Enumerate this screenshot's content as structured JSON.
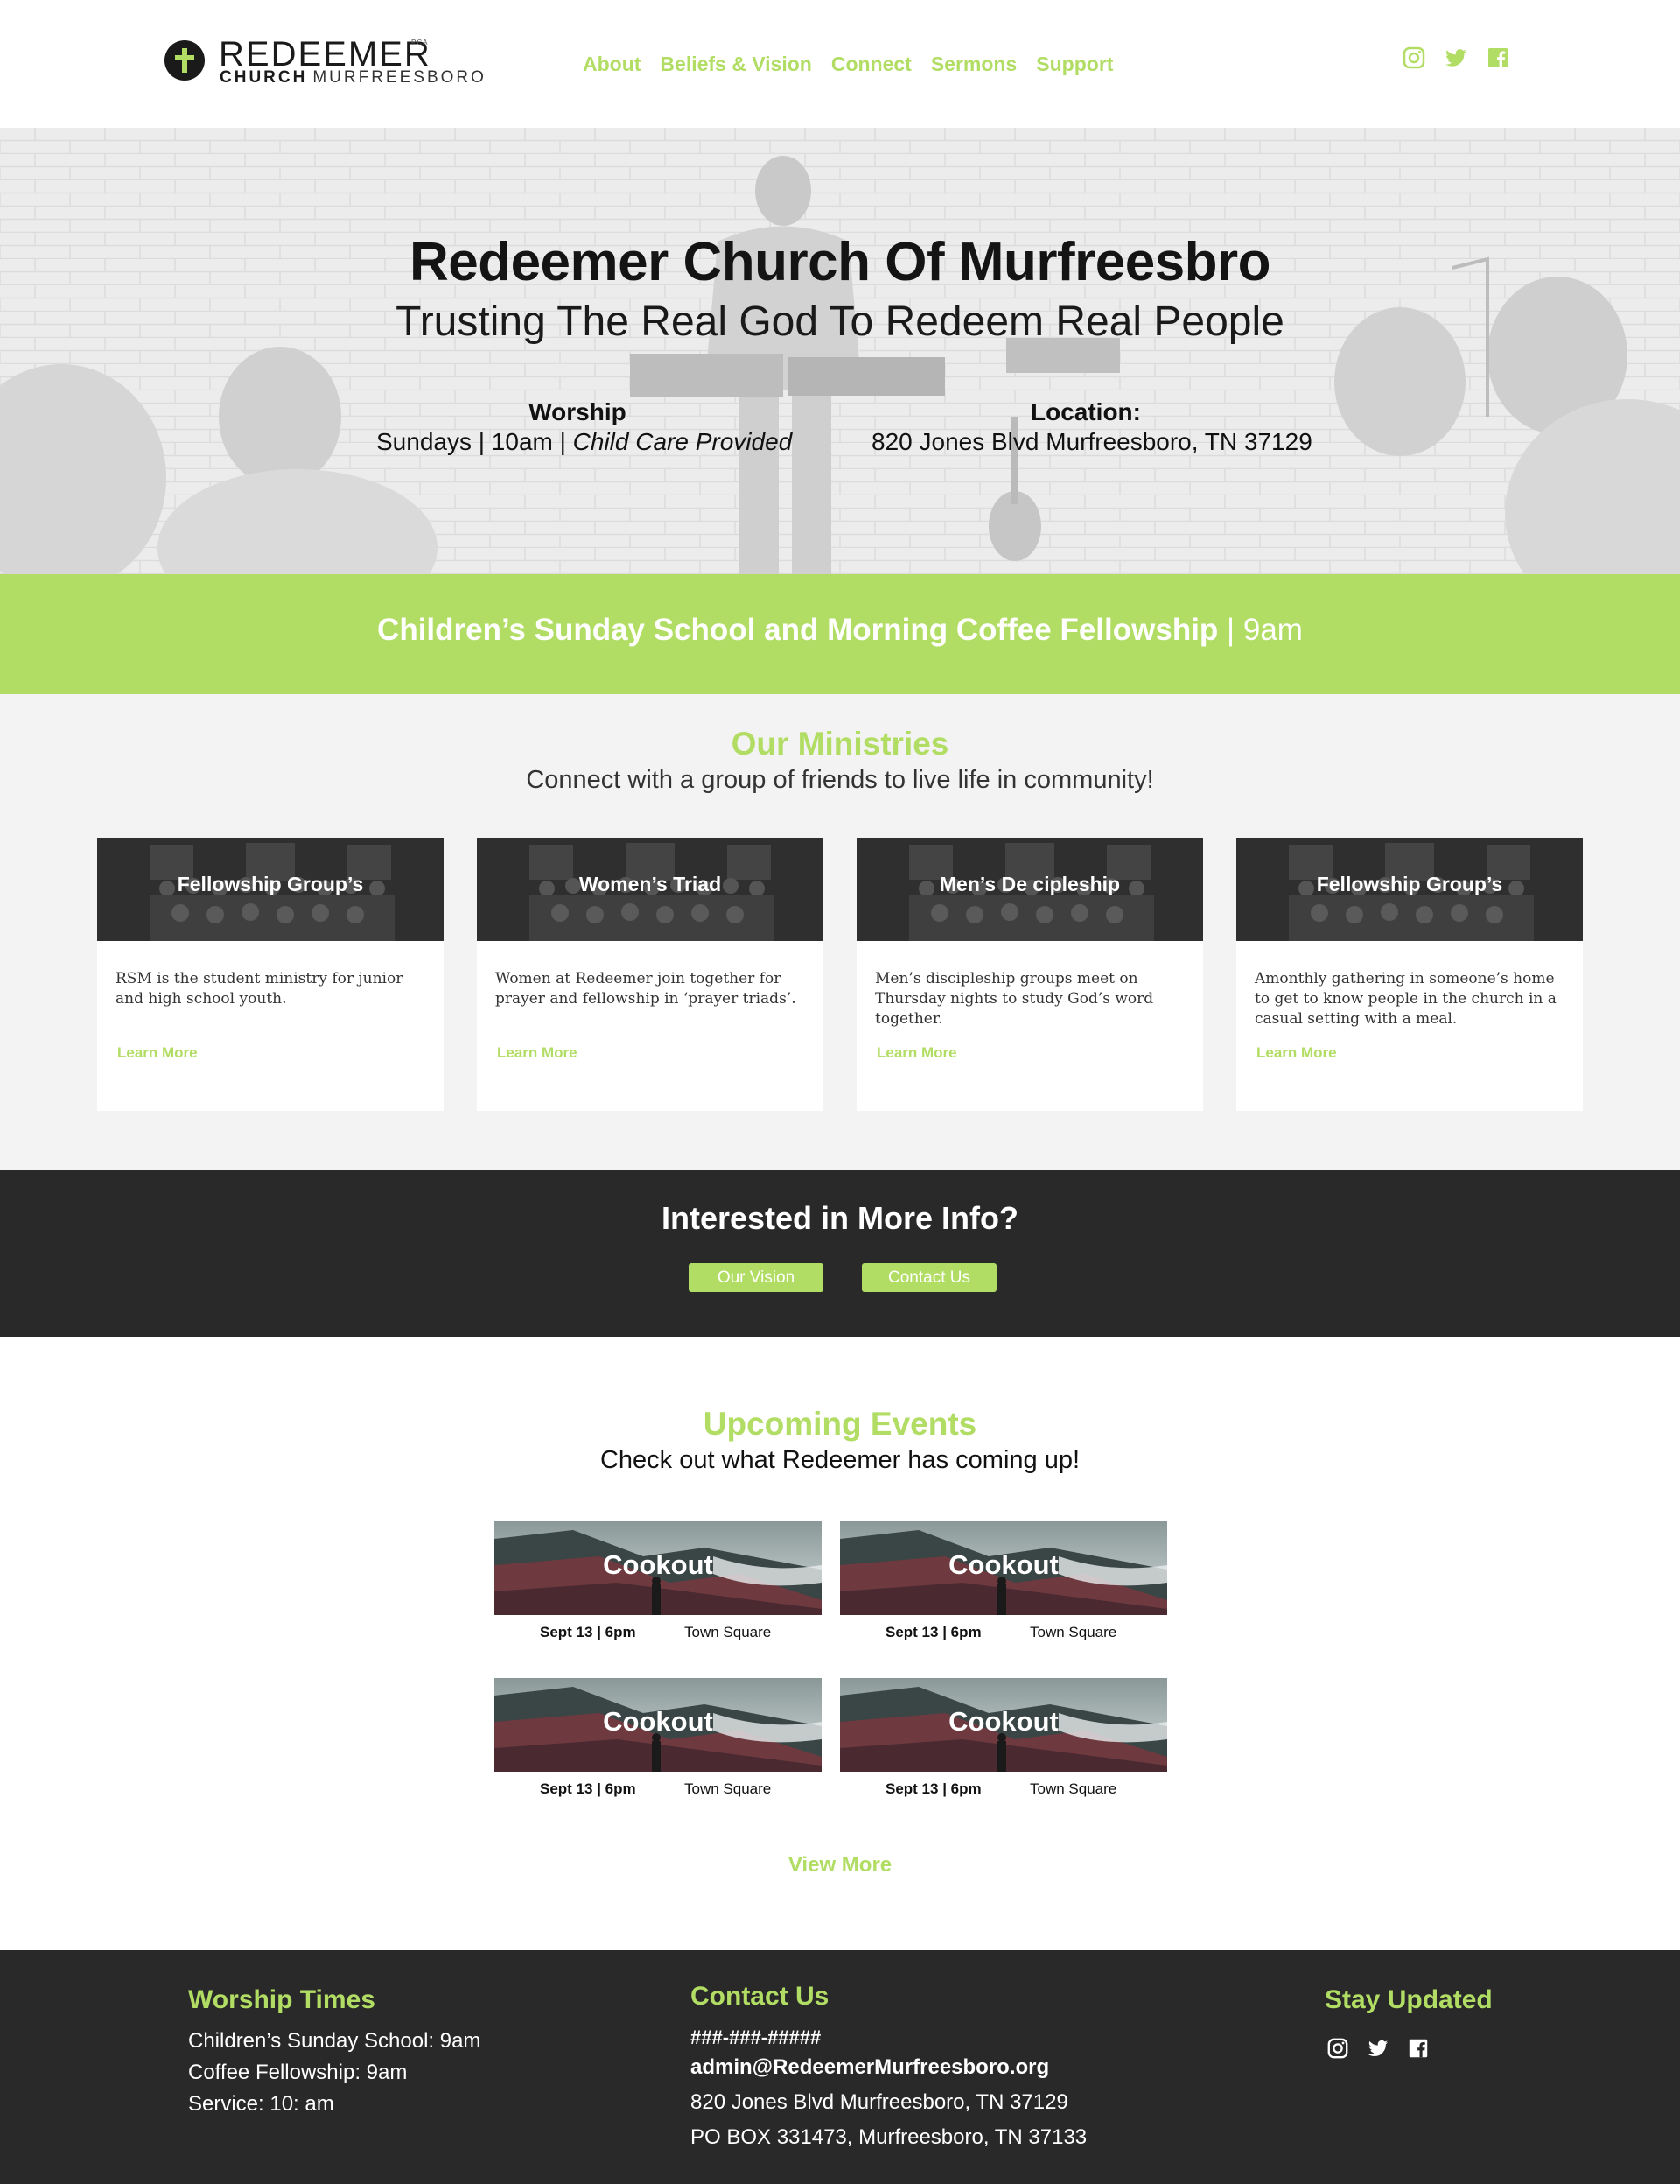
{
  "brand": {
    "name_line1": "REDEEMER",
    "pca": "PCA",
    "name_bold": "CHURCH",
    "name_light": "MURFREESBORO"
  },
  "nav": {
    "items": [
      "About",
      "Beliefs & Vision",
      "Connect",
      "Sermons",
      "Support"
    ]
  },
  "social": {
    "icons": [
      "instagram-icon",
      "twitter-icon",
      "facebook-icon"
    ],
    "color": "#b2dd64"
  },
  "hero": {
    "title": "Redeemer Church Of Murfreesbro",
    "subtitle": "Trusting The Real God  To Redeem Real People",
    "worship_heading": "Worship",
    "worship_text": "Sundays | 10am | ",
    "worship_italic": "Child Care Provided",
    "location_heading": "Location:",
    "location_text": "820 Jones Blvd Murfreesboro, TN 37129"
  },
  "banner": {
    "bold": "Children’s Sunday School and Morning Coffee Fellowship",
    "rest": " | 9am"
  },
  "ministries": {
    "title": "Our Ministries",
    "subtitle": "Connect with a group of friends to live life in community!",
    "cards": [
      {
        "title": "Fellowship Group’s",
        "desc": "RSM is the student ministry for junior and high school youth.",
        "link": "Learn More"
      },
      {
        "title": "Women’s Triad",
        "desc": "Women at Redeemer join together for prayer and fellowship in ‘prayer triads’.",
        "link": "Learn More"
      },
      {
        "title": "Men’s De cipleship",
        "desc": "Men’s discipleship groups meet on Thursday nights to study God’s word together.",
        "link": "Learn More"
      },
      {
        "title": "Fellowship Group’s",
        "desc": " Amonthly gathering in someone’s home to get to know people in the church in a casual setting with a meal.",
        "link": "Learn More"
      }
    ]
  },
  "info": {
    "title": "Interested in More Info?",
    "btn_vision": "Our Vision",
    "btn_contact": "Contact Us"
  },
  "events": {
    "title": "Upcoming Events",
    "subtitle": "Check out what Redeemer has coming up!",
    "items": [
      {
        "title": "Cookout",
        "date": "Sept 13 | 6pm",
        "location": "Town Square"
      },
      {
        "title": "Cookout",
        "date": "Sept 13 | 6pm",
        "location": "Town Square"
      },
      {
        "title": "Cookout",
        "date": "Sept 13 | 6pm",
        "location": "Town Square"
      },
      {
        "title": "Cookout",
        "date": "Sept 13 | 6pm",
        "location": "Town Square"
      }
    ],
    "view_more": "View More"
  },
  "footer": {
    "worship_heading": "Worship Times",
    "worship_lines": [
      "Children’s Sunday School: 9am",
      "Coffee Fellowship: 9am",
      "Service: 10: am"
    ],
    "contact_heading": "Contact Us",
    "phone": "###-###-#####",
    "email": "admin@RedeemerMurfreesboro.org",
    "address": "820 Jones Blvd Murfreesboro, TN 37129",
    "po_box": "PO BOX 331473, Murfreesboro, TN 37133",
    "updates_heading": "Stay Updated"
  },
  "colors": {
    "accent": "#b2dd64",
    "dark": "#292929",
    "light_bg": "#f3f3f3"
  }
}
